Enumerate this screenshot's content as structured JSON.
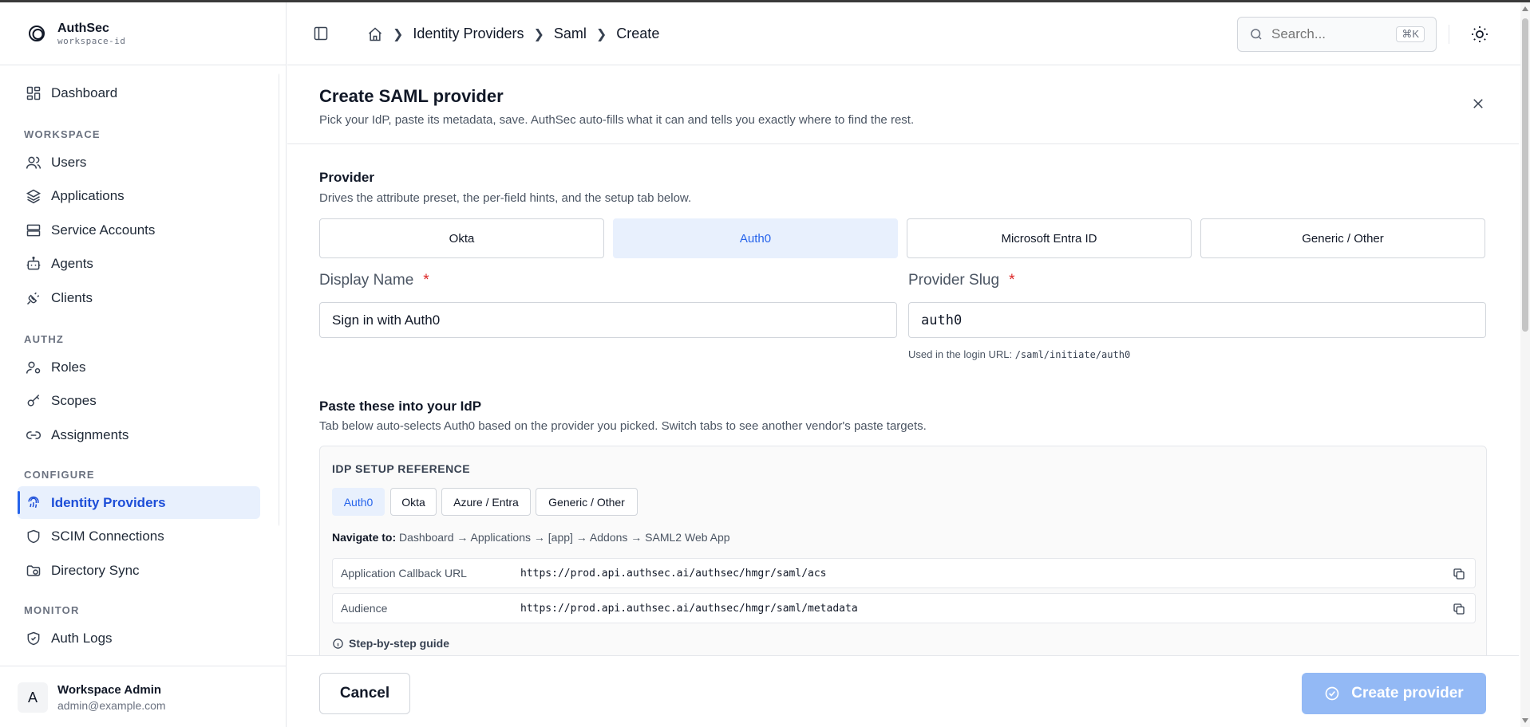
{
  "brand": {
    "name": "AuthSec",
    "workspace": "workspace-id"
  },
  "sidebar": {
    "dashboard": "Dashboard",
    "sections": {
      "workspace": "WORKSPACE",
      "authz": "AUTHZ",
      "configure": "CONFIGURE",
      "monitor": "MONITOR"
    },
    "items": {
      "users": "Users",
      "applications": "Applications",
      "service_accounts": "Service Accounts",
      "agents": "Agents",
      "clients": "Clients",
      "roles": "Roles",
      "scopes": "Scopes",
      "assignments": "Assignments",
      "identity_providers": "Identity Providers",
      "scim": "SCIM Connections",
      "directory_sync": "Directory Sync",
      "auth_logs": "Auth Logs"
    },
    "active": "identity_providers",
    "user": {
      "initial": "A",
      "name": "Workspace Admin",
      "email": "admin@example.com"
    }
  },
  "header": {
    "breadcrumbs": [
      "Identity Providers",
      "Saml",
      "Create"
    ],
    "search_placeholder": "Search...",
    "search_shortcut": "⌘K"
  },
  "page": {
    "title": "Create SAML provider",
    "subtitle": "Pick your IdP, paste its metadata, save. AuthSec auto-fills what it can and tells you exactly where to find the rest."
  },
  "provider_section": {
    "title": "Provider",
    "subtitle": "Drives the attribute preset, the per-field hints, and the setup tab below.",
    "options": [
      "Okta",
      "Auth0",
      "Microsoft Entra ID",
      "Generic / Other"
    ],
    "selected": "Auth0"
  },
  "fields": {
    "display_name": {
      "label": "Display Name",
      "required": "*",
      "value": "Sign in with Auth0"
    },
    "provider_slug": {
      "label": "Provider Slug",
      "required": "*",
      "value": "auth0"
    },
    "slug_hint_prefix": "Used in the login URL: ",
    "slug_hint_code": "/saml/initiate/auth0"
  },
  "idp_section": {
    "title": "Paste these into your IdP",
    "subtitle": "Tab below auto-selects Auth0 based on the provider you picked. Switch tabs to see another vendor's paste targets.",
    "reference_title": "IDP SETUP REFERENCE",
    "tabs": [
      "Auth0",
      "Okta",
      "Azure / Entra",
      "Generic / Other"
    ],
    "active_tab": "Auth0",
    "navigate_label": "Navigate to:",
    "navigate_path": " Dashboard → Applications → [app] → Addons → SAML2 Web App",
    "rows": [
      {
        "key": "Application Callback URL",
        "value": "https://prod.api.authsec.ai/authsec/hmgr/saml/acs"
      },
      {
        "key": "Audience",
        "value": "https://prod.api.authsec.ai/authsec/hmgr/saml/metadata"
      }
    ],
    "guide": "Step-by-step guide"
  },
  "footer": {
    "cancel": "Cancel",
    "create": "Create provider"
  },
  "colors": {
    "accent": "#2563eb",
    "accent_bg": "#e8f0fd",
    "create_disabled": "#93b9f5",
    "required": "#dc2626"
  }
}
